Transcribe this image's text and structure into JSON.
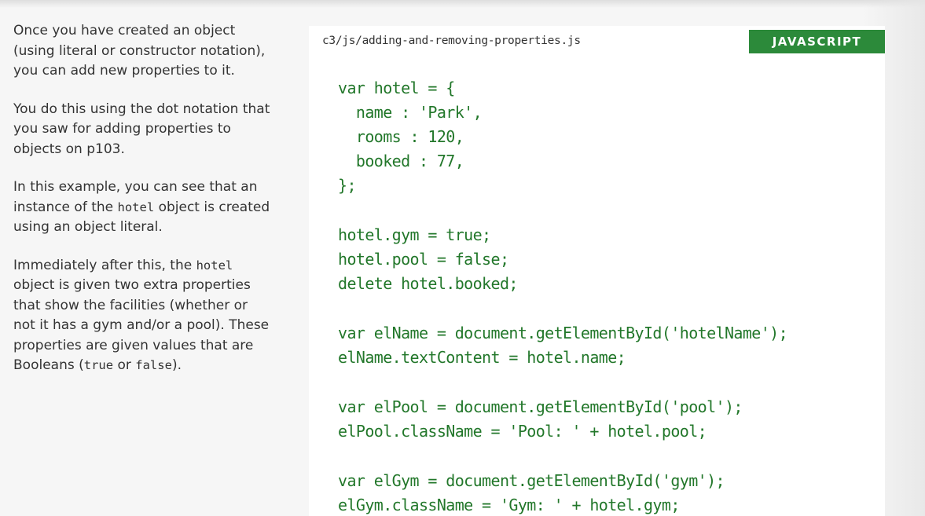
{
  "text": {
    "p1": "Once you have created an object (using literal or constructor notation), you can add new properties to it.",
    "p2": "You do this using the dot notation that you saw for adding properties to objects on p103.",
    "p3_before": "In this example, you can see that an instance of the ",
    "p3_code": "hotel",
    "p3_after": " object is created using an object literal.",
    "p4_a": "Immediately after this, the ",
    "p4_code": "hotel",
    "p4_b": " object is given two extra properties that show the facilities (whether or not it has a gym and/or a pool). These properties are given values that are Booleans (",
    "p4_true": "true",
    "p4_or": " or ",
    "p4_false": "false",
    "p4_end": ")."
  },
  "code_panel": {
    "file_path": "c3/js/adding-and-removing-properties.js",
    "language": "JAVASCRIPT",
    "accent_color": "#2c8a3a",
    "code_color": "#22772a",
    "blocks": [
      [
        "var hotel = {",
        "  name : 'Park',",
        "  rooms : 120,",
        "  booked : 77,",
        "};"
      ],
      [
        "hotel.gym = true;",
        "hotel.pool = false;",
        "delete hotel.booked;"
      ],
      [
        "var elName = document.getElementById('hotelName');",
        "elName.textContent = hotel.name;"
      ],
      [
        "var elPool = document.getElementById('pool');",
        "elPool.className = 'Pool: ' + hotel.pool;"
      ],
      [
        "var elGym = document.getElementById('gym');",
        "elGym.className = 'Gym: ' + hotel.gym;"
      ]
    ]
  }
}
